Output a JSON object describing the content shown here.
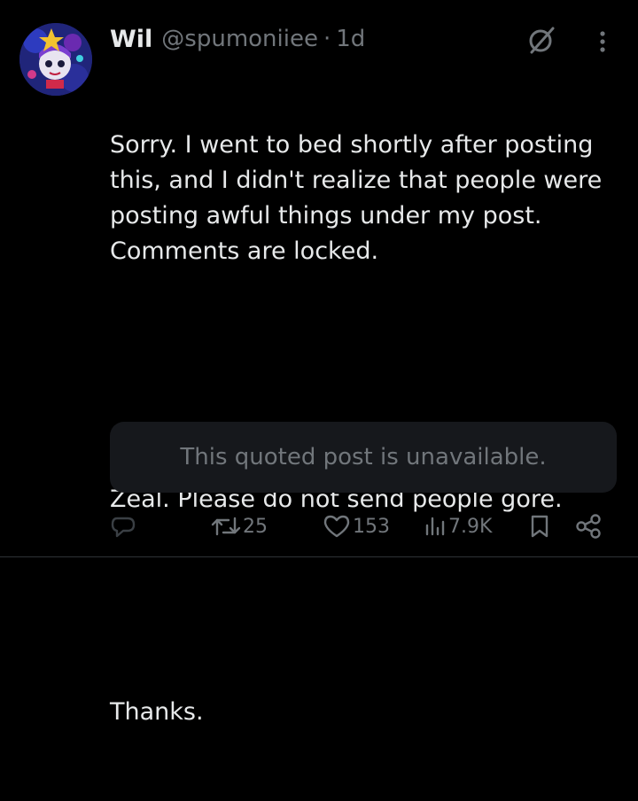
{
  "author": {
    "display_name": "Wil",
    "handle": "@spumoniiee",
    "separator": "·",
    "time": "1d"
  },
  "post": {
    "paragraphs": [
      "Sorry. I went to bed shortly after posting this, and I didn't realize that people were posting awful things under my post. Comments are locked.",
      "Please do not use my document to defend Zeal. Please do not send people gore.",
      "Thanks."
    ]
  },
  "quote": {
    "text": "This quoted post is unavailable."
  },
  "actions": {
    "reply": {
      "icon": "reply-icon",
      "count": ""
    },
    "repost": {
      "icon": "repost-icon",
      "count": "25"
    },
    "like": {
      "icon": "heart-icon",
      "count": "153"
    },
    "views": {
      "icon": "views-icon",
      "count": "7.9K"
    },
    "bookmark": {
      "icon": "bookmark-icon"
    },
    "share": {
      "icon": "share-icon"
    }
  },
  "colors": {
    "background": "#000000",
    "text_primary": "#e7e9ea",
    "text_secondary": "#71767b",
    "quote_bg": "#16181c",
    "reply_icon": "#3a3f44"
  }
}
